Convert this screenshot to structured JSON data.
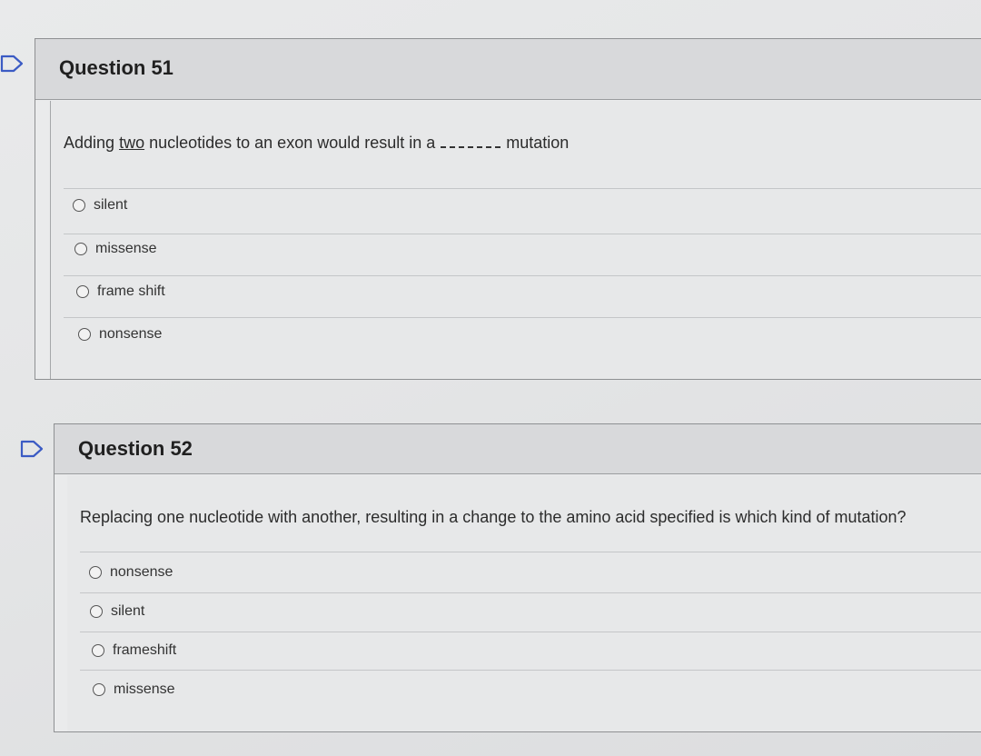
{
  "questions": [
    {
      "title": "Question 51",
      "text_before": "Adding ",
      "text_emphasis": "two",
      "text_after": " nucleotides to an exon would result in a",
      "text_end": "mutation",
      "options": [
        "silent",
        "missense",
        "frame shift",
        "nonsense"
      ]
    },
    {
      "title": "Question 52",
      "text": "Replacing one nucleotide with another, resulting in a change to the amino acid specified is which kind of mutation?",
      "options": [
        "nonsense",
        "silent",
        "frameshift",
        "missense"
      ]
    }
  ]
}
